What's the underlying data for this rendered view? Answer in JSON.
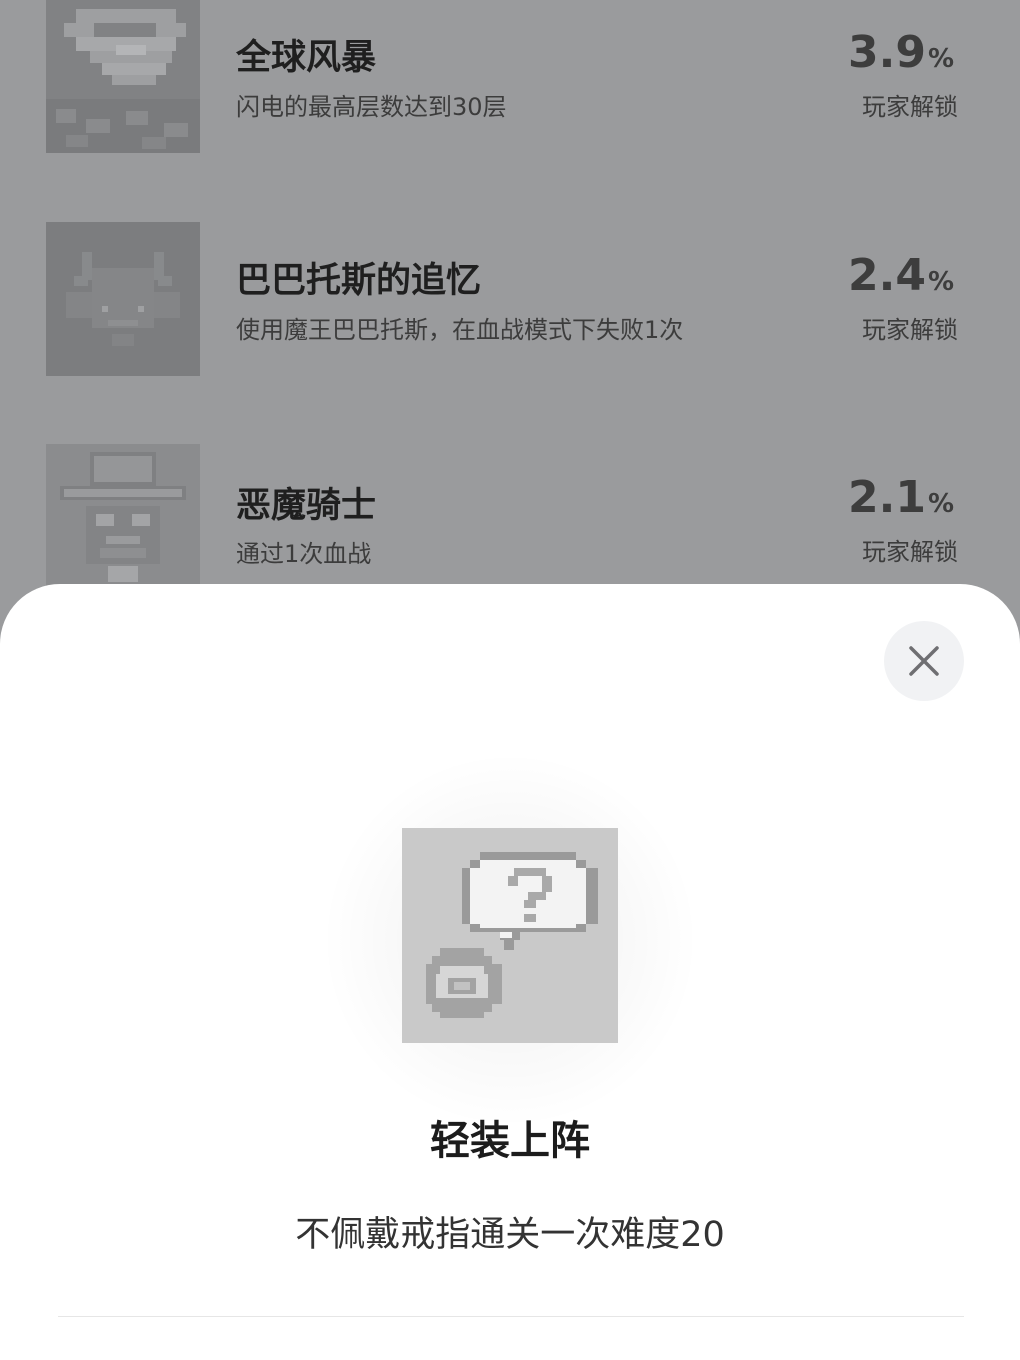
{
  "achievements": [
    {
      "title": "全球风暴",
      "description": "闪电的最高层数达到30层",
      "percent": "3.9",
      "percent_sign": "%",
      "unlock_label": "玩家解锁",
      "icon": "storm-icon"
    },
    {
      "title": "巴巴托斯的追忆",
      "description": "使用魔王巴巴托斯，在血战模式下失败1次",
      "percent": "2.4",
      "percent_sign": "%",
      "unlock_label": "玩家解锁",
      "icon": "demon-face-icon"
    },
    {
      "title": "恶魔骑士",
      "description": "通过1次血战",
      "percent": "2.1",
      "percent_sign": "%",
      "unlock_label": "玩家解锁",
      "icon": "hat-knight-icon"
    }
  ],
  "detail": {
    "title": "轻装上阵",
    "description": "不佩戴戒指通关一次难度20",
    "icon": "ring-question-icon",
    "close_icon": "close-icon"
  },
  "colors": {
    "overlay": "#9a9b9d",
    "sheet": "#ffffff",
    "close_bg": "#f1f2f4"
  }
}
